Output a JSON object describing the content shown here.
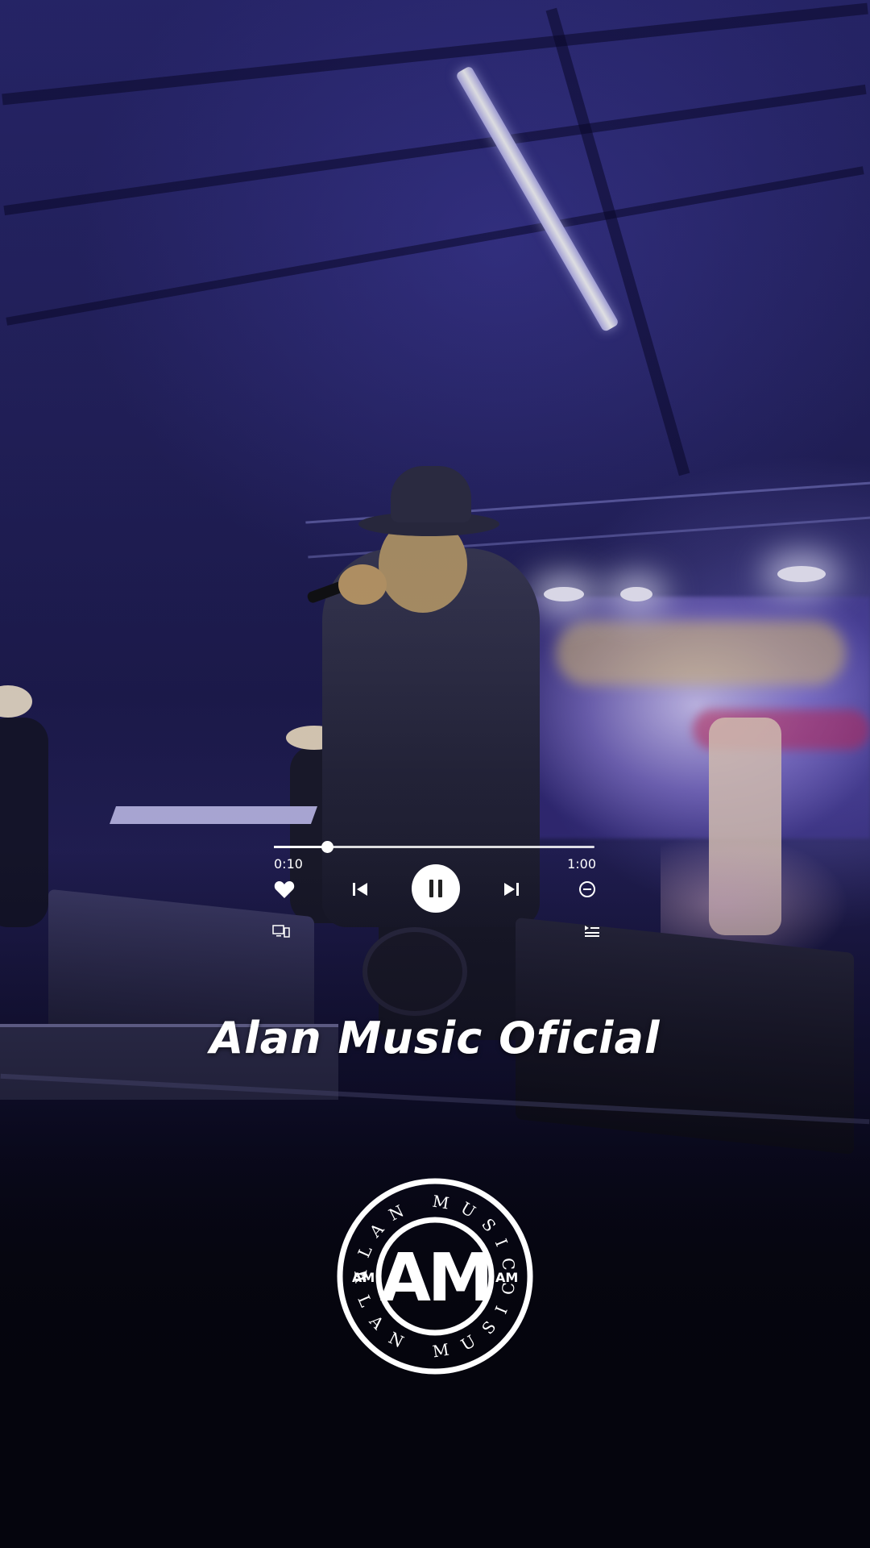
{
  "player": {
    "current_time": "0:10",
    "total_time": "1:00",
    "progress": 0.167,
    "state": "playing",
    "controls": [
      "heart-icon",
      "previous-icon",
      "pause-icon",
      "next-icon",
      "minus-circle-icon",
      "cast-icon",
      "queue-icon"
    ]
  },
  "channel": {
    "name": "Alan Music Oficial"
  },
  "logo": {
    "monogram": "AM",
    "ring_text": "ALAN MUSIC",
    "side_mark": "AM"
  },
  "colors": {
    "accent": "#ffffff",
    "background": "#05050d"
  }
}
